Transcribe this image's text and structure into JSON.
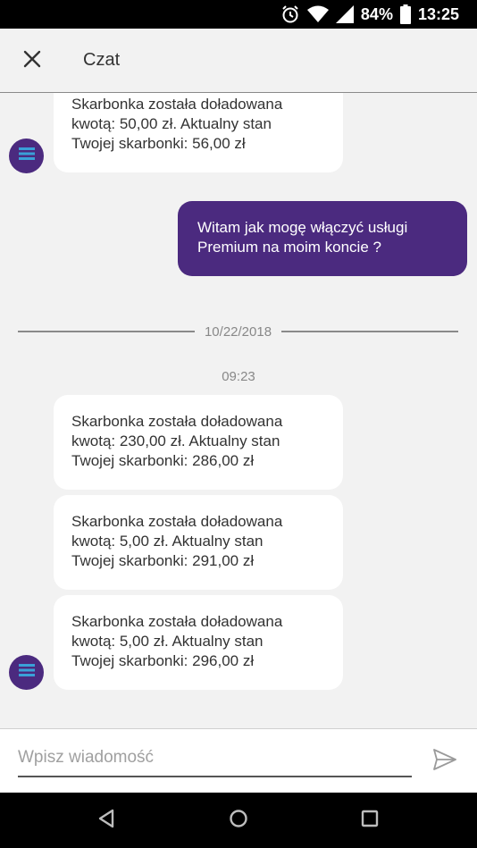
{
  "status_bar": {
    "battery": "84%",
    "time": "13:25",
    "icons": [
      "alarm-icon",
      "wifi-icon",
      "signal-icon",
      "battery-icon"
    ]
  },
  "header": {
    "title": "Czat",
    "close_icon": "close-icon"
  },
  "messages": {
    "top_partial": {
      "line1": "Skarbonka została doładowana",
      "line2": "kwotą: 50,00 zł. Aktualny stan",
      "line3": "Twojej skarbonki: 56,00 zł"
    },
    "user": {
      "line1": "Witam jak mogę włączyć usługi",
      "line2": "Premium na moim koncie ?"
    },
    "date": "10/22/2018",
    "time": "09:23",
    "bot": [
      {
        "line1": "Skarbonka została doładowana",
        "line2": "kwotą: 230,00 zł. Aktualny stan",
        "line3": "Twojej skarbonki: 286,00 zł"
      },
      {
        "line1": "Skarbonka została doładowana",
        "line2": "kwotą: 5,00 zł. Aktualny stan",
        "line3": "Twojej skarbonki: 291,00 zł"
      },
      {
        "line1": "Skarbonka została doładowana",
        "line2": "kwotą: 5,00 zł. Aktualny stan",
        "line3": "Twojej skarbonki: 296,00 zł"
      }
    ]
  },
  "composer": {
    "placeholder": "Wpisz wiadomość",
    "value": "",
    "send_icon": "send-icon"
  },
  "nav_bar": {
    "icons": [
      "back-icon",
      "home-icon",
      "recents-icon"
    ]
  },
  "colors": {
    "accent": "#4b2a7f",
    "background": "#f2f2f2",
    "bubble_incoming": "#ffffff"
  }
}
